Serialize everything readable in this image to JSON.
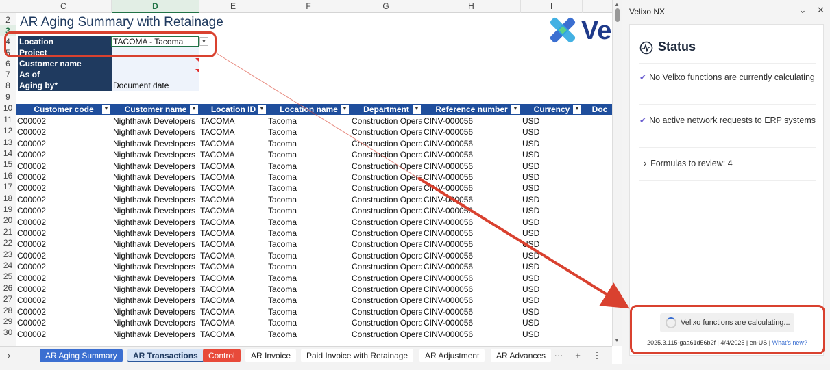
{
  "columns": [
    "C",
    "D",
    "E",
    "F",
    "G",
    "H",
    "I"
  ],
  "selected_column": "D",
  "row_numbers": [
    "2",
    "3",
    "4",
    "5",
    "6",
    "7",
    "8",
    "9",
    "10",
    "11",
    "12",
    "13",
    "14",
    "15",
    "16",
    "17",
    "18",
    "19",
    "20",
    "21",
    "22",
    "23",
    "24",
    "25",
    "26",
    "27",
    "28",
    "29",
    "30"
  ],
  "title": "AR Aging Summary with Retainage",
  "logo_text": "Ve",
  "params": [
    {
      "label": "Location",
      "value": "TACOMA - Tacoma"
    },
    {
      "label": "Project",
      "value": ""
    },
    {
      "label": "Customer name",
      "value": ""
    },
    {
      "label": "As of",
      "value": ""
    },
    {
      "label": "Aging by*",
      "value": "Document date"
    }
  ],
  "table_headers": [
    "Customer code",
    "Customer name",
    "Location ID",
    "Location name",
    "Department",
    "Reference number",
    "Currency",
    "Doc"
  ],
  "rows": [
    {
      "code": "C00002",
      "name": "Nighthawk Developers",
      "loc_id": "TACOMA",
      "loc_name": "Tacoma",
      "dept": "Construction Opera",
      "ref": "CINV-000056",
      "cur": "USD"
    },
    {
      "code": "C00002",
      "name": "Nighthawk Developers",
      "loc_id": "TACOMA",
      "loc_name": "Tacoma",
      "dept": "Construction Opera",
      "ref": "CINV-000056",
      "cur": "USD"
    },
    {
      "code": "C00002",
      "name": "Nighthawk Developers",
      "loc_id": "TACOMA",
      "loc_name": "Tacoma",
      "dept": "Construction Opera",
      "ref": "CINV-000056",
      "cur": "USD"
    },
    {
      "code": "C00002",
      "name": "Nighthawk Developers",
      "loc_id": "TACOMA",
      "loc_name": "Tacoma",
      "dept": "Construction Opera",
      "ref": "CINV-000056",
      "cur": "USD"
    },
    {
      "code": "C00002",
      "name": "Nighthawk Developers",
      "loc_id": "TACOMA",
      "loc_name": "Tacoma",
      "dept": "Construction Opera",
      "ref": "CINV-000056",
      "cur": "USD"
    },
    {
      "code": "C00002",
      "name": "Nighthawk Developers",
      "loc_id": "TACOMA",
      "loc_name": "Tacoma",
      "dept": "Construction Opera",
      "ref": "CINV-000056",
      "cur": "USD"
    },
    {
      "code": "C00002",
      "name": "Nighthawk Developers",
      "loc_id": "TACOMA",
      "loc_name": "Tacoma",
      "dept": "Construction Opera",
      "ref": "CINV-000056",
      "cur": "USD"
    },
    {
      "code": "C00002",
      "name": "Nighthawk Developers",
      "loc_id": "TACOMA",
      "loc_name": "Tacoma",
      "dept": "Construction Opera",
      "ref": "CINV-000056",
      "cur": "USD"
    },
    {
      "code": "C00002",
      "name": "Nighthawk Developers",
      "loc_id": "TACOMA",
      "loc_name": "Tacoma",
      "dept": "Construction Opera",
      "ref": "CINV-000056",
      "cur": "USD"
    },
    {
      "code": "C00002",
      "name": "Nighthawk Developers",
      "loc_id": "TACOMA",
      "loc_name": "Tacoma",
      "dept": "Construction Opera",
      "ref": "CINV-000056",
      "cur": "USD"
    },
    {
      "code": "C00002",
      "name": "Nighthawk Developers",
      "loc_id": "TACOMA",
      "loc_name": "Tacoma",
      "dept": "Construction Opera",
      "ref": "CINV-000056",
      "cur": "USD"
    },
    {
      "code": "C00002",
      "name": "Nighthawk Developers",
      "loc_id": "TACOMA",
      "loc_name": "Tacoma",
      "dept": "Construction Opera",
      "ref": "CINV-000056",
      "cur": "USD"
    },
    {
      "code": "C00002",
      "name": "Nighthawk Developers",
      "loc_id": "TACOMA",
      "loc_name": "Tacoma",
      "dept": "Construction Opera",
      "ref": "CINV-000056",
      "cur": "USD"
    },
    {
      "code": "C00002",
      "name": "Nighthawk Developers",
      "loc_id": "TACOMA",
      "loc_name": "Tacoma",
      "dept": "Construction Opera",
      "ref": "CINV-000056",
      "cur": "USD"
    },
    {
      "code": "C00002",
      "name": "Nighthawk Developers",
      "loc_id": "TACOMA",
      "loc_name": "Tacoma",
      "dept": "Construction Opera",
      "ref": "CINV-000056",
      "cur": "USD"
    },
    {
      "code": "C00002",
      "name": "Nighthawk Developers",
      "loc_id": "TACOMA",
      "loc_name": "Tacoma",
      "dept": "Construction Opera",
      "ref": "CINV-000056",
      "cur": "USD"
    },
    {
      "code": "C00002",
      "name": "Nighthawk Developers",
      "loc_id": "TACOMA",
      "loc_name": "Tacoma",
      "dept": "Construction Opera",
      "ref": "CINV-000056",
      "cur": "USD"
    },
    {
      "code": "C00002",
      "name": "Nighthawk Developers",
      "loc_id": "TACOMA",
      "loc_name": "Tacoma",
      "dept": "Construction Opera",
      "ref": "CINV-000056",
      "cur": "USD"
    },
    {
      "code": "C00002",
      "name": "Nighthawk Developers",
      "loc_id": "TACOMA",
      "loc_name": "Tacoma",
      "dept": "Construction Opera",
      "ref": "CINV-000056",
      "cur": "USD"
    },
    {
      "code": "C00002",
      "name": "Nighthawk Developers",
      "loc_id": "TACOMA",
      "loc_name": "Tacoma",
      "dept": "Construction Opera",
      "ref": "CINV-000056",
      "cur": "USD"
    }
  ],
  "tabs": [
    {
      "label": "AR Aging Summary",
      "style": "blue"
    },
    {
      "label": "AR Transactions",
      "style": "active"
    },
    {
      "label": "Control",
      "style": "red"
    },
    {
      "label": "AR Invoice",
      "style": "plain"
    },
    {
      "label": "Paid Invoice with Retainage",
      "style": "plain"
    },
    {
      "label": "AR Adjustment",
      "style": "plain"
    },
    {
      "label": "AR Advances",
      "style": "plain"
    }
  ],
  "panel": {
    "title": "Velixo NX",
    "status_heading": "Status",
    "status_items": [
      "No Velixo functions are currently calculating",
      "No active network requests to ERP systems"
    ],
    "formulas": "Formulas to review: 4",
    "calculating": "Velixo functions are calculating...",
    "version": "2025.3.115-gaa61d56b2f | 4/4/2025 | en-US | ",
    "whats_new": "What's new?"
  },
  "colors": {
    "accent": "#1f4e9c",
    "highlight": "#d9412f",
    "active_tab": "#3b6fd1",
    "control_tab": "#e84a3a"
  }
}
